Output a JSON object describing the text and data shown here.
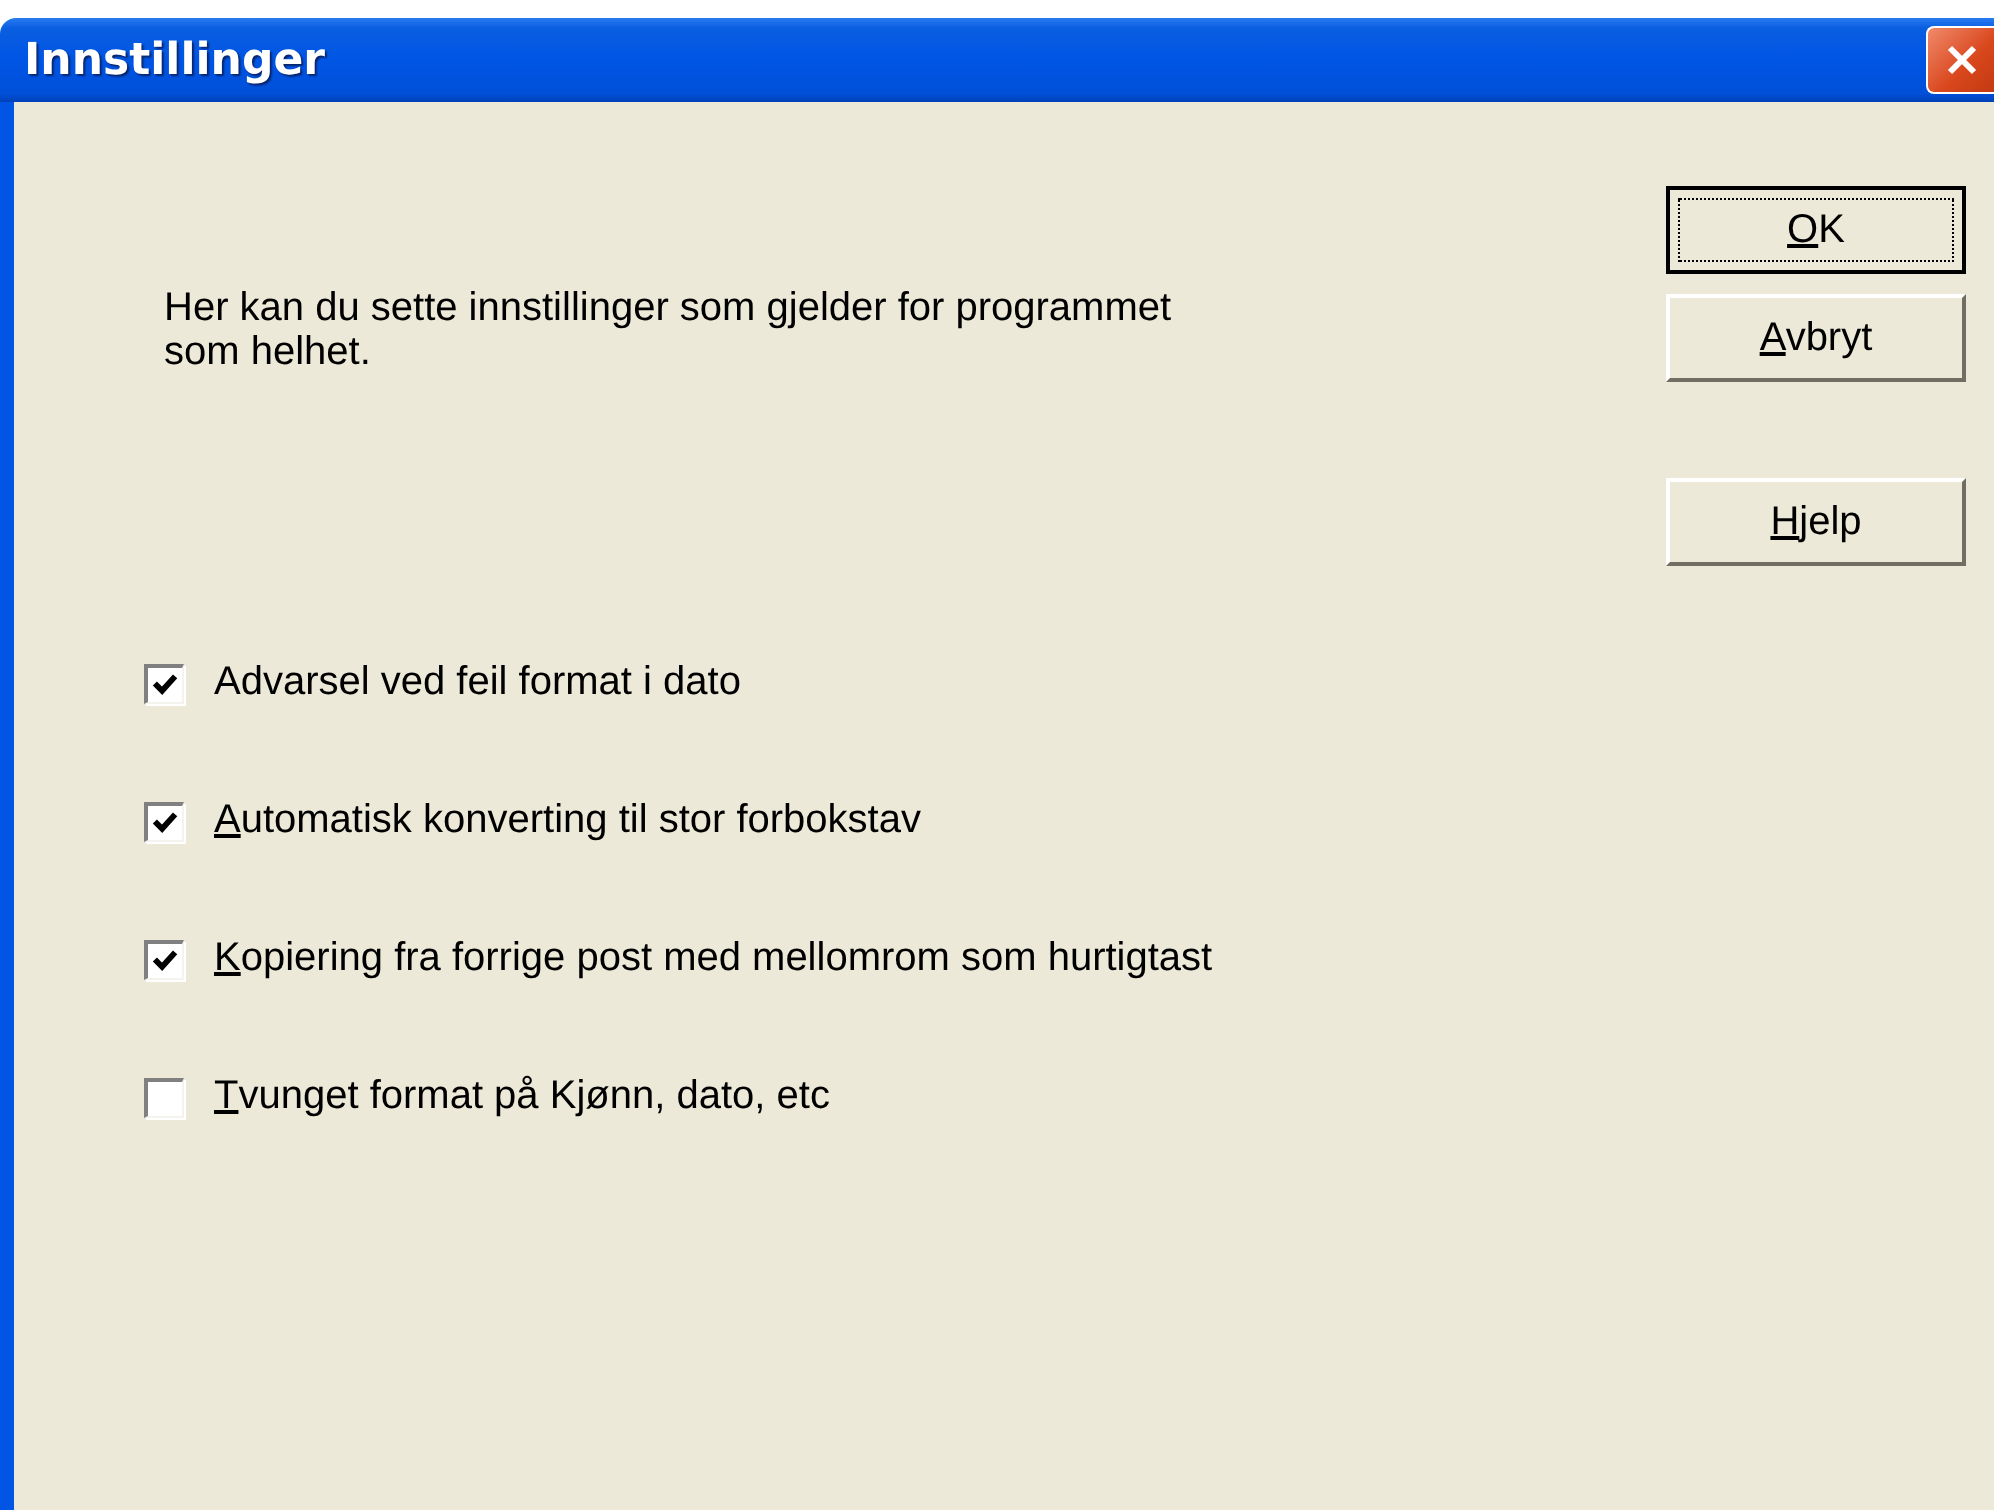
{
  "window": {
    "title": "Innstillinger"
  },
  "description": "Her kan du sette innstillinger som gjelder for programmet som helhet.",
  "buttons": [
    {
      "label": "OK",
      "default": true,
      "mnemonic": true
    },
    {
      "label": "Avbryt",
      "default": false,
      "mnemonic": true
    },
    {
      "label": "Hjelp",
      "default": false,
      "mnemonic": true
    }
  ],
  "options": [
    {
      "label": "Advarsel ved feil format i dato",
      "checked": true,
      "mnemonic": false
    },
    {
      "label": "Automatisk konverting til stor forbokstav",
      "checked": true,
      "mnemonic": true
    },
    {
      "label": "Kopiering fra forrige post med mellomrom som hurtigtast",
      "checked": true,
      "mnemonic": true
    },
    {
      "label": "Tvunget format på Kjønn, dato, etc",
      "checked": false,
      "mnemonic": true
    }
  ]
}
